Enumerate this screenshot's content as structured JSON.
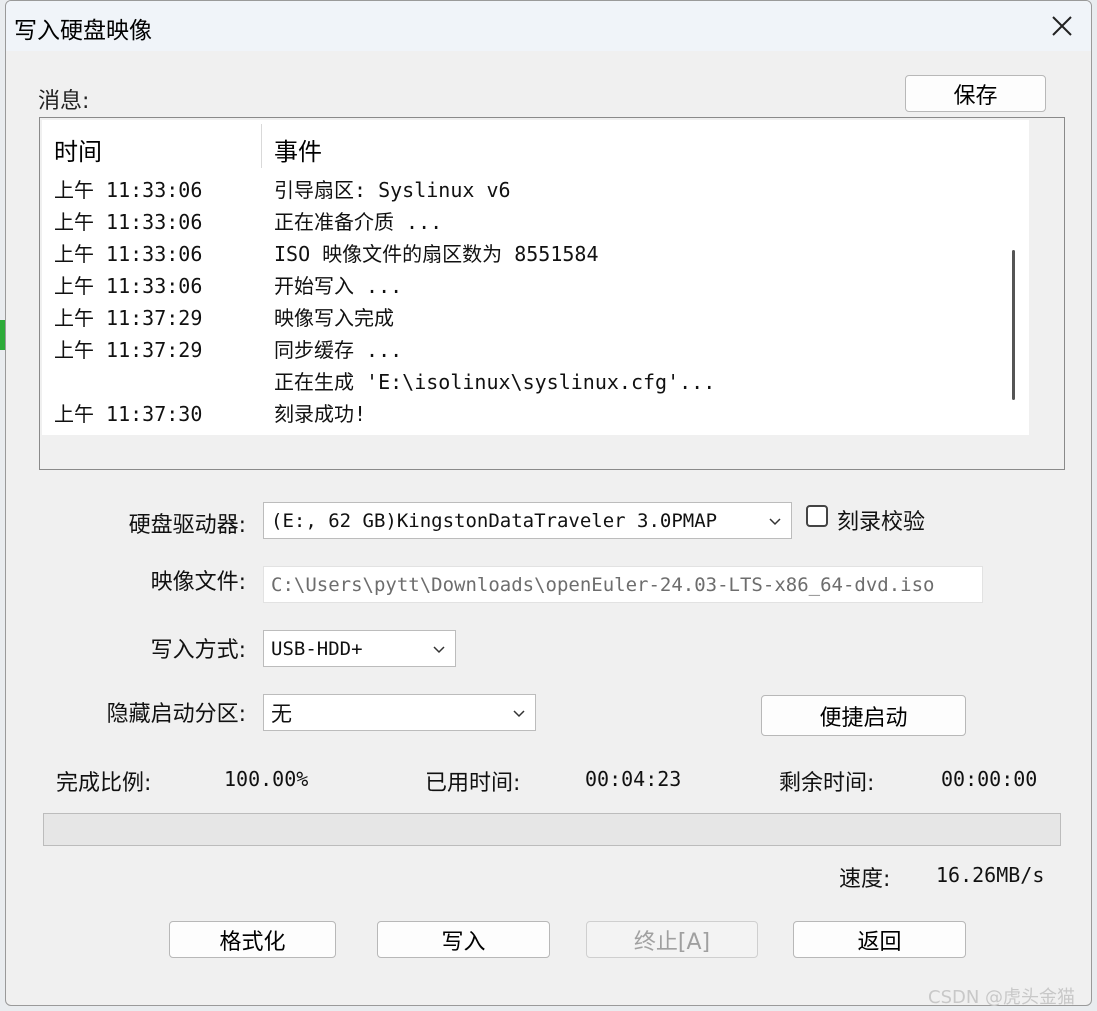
{
  "window": {
    "title": "写入硬盘映像",
    "close_icon": "close-icon"
  },
  "messages": {
    "label": "消息:",
    "save_label": "保存",
    "columns": {
      "time": "时间",
      "event": "事件"
    },
    "rows": [
      {
        "time": "上午 11:33:06",
        "event": "引导扇区: Syslinux v6"
      },
      {
        "time": "上午 11:33:06",
        "event": "正在准备介质 ..."
      },
      {
        "time": "上午 11:33:06",
        "event": "ISO 映像文件的扇区数为 8551584"
      },
      {
        "time": "上午 11:33:06",
        "event": "开始写入 ..."
      },
      {
        "time": "上午 11:37:29",
        "event": "映像写入完成"
      },
      {
        "time": "上午 11:37:29",
        "event": "同步缓存 ..."
      },
      {
        "time": "",
        "event": "正在生成 'E:\\isolinux\\syslinux.cfg'..."
      },
      {
        "time": "上午 11:37:30",
        "event": "刻录成功!"
      }
    ]
  },
  "form": {
    "drive_label": "硬盘驱动器:",
    "drive_value": "(E:, 62 GB)KingstonDataTraveler 3.0PMAP",
    "verify_label": "刻录校验",
    "verify_checked": false,
    "image_label": "映像文件:",
    "image_value": "C:\\Users\\pytt\\Downloads\\openEuler-24.03-LTS-x86_64-dvd.iso",
    "method_label": "写入方式:",
    "method_value": "USB-HDD+",
    "hidden_label": "隐藏启动分区:",
    "hidden_value": "无",
    "quick_boot_label": "便捷启动"
  },
  "status": {
    "percent_label": "完成比例:",
    "percent_value": "100.00%",
    "elapsed_label": "已用时间:",
    "elapsed_value": "00:04:23",
    "remaining_label": "剩余时间:",
    "remaining_value": "00:00:00",
    "speed_label": "速度:",
    "speed_value": "16.26MB/s",
    "progress_fraction": 1.0
  },
  "actions": {
    "format_label": "格式化",
    "write_label": "写入",
    "stop_label": "终止[A]",
    "back_label": "返回"
  },
  "watermark": "CSDN @虎头金猫"
}
